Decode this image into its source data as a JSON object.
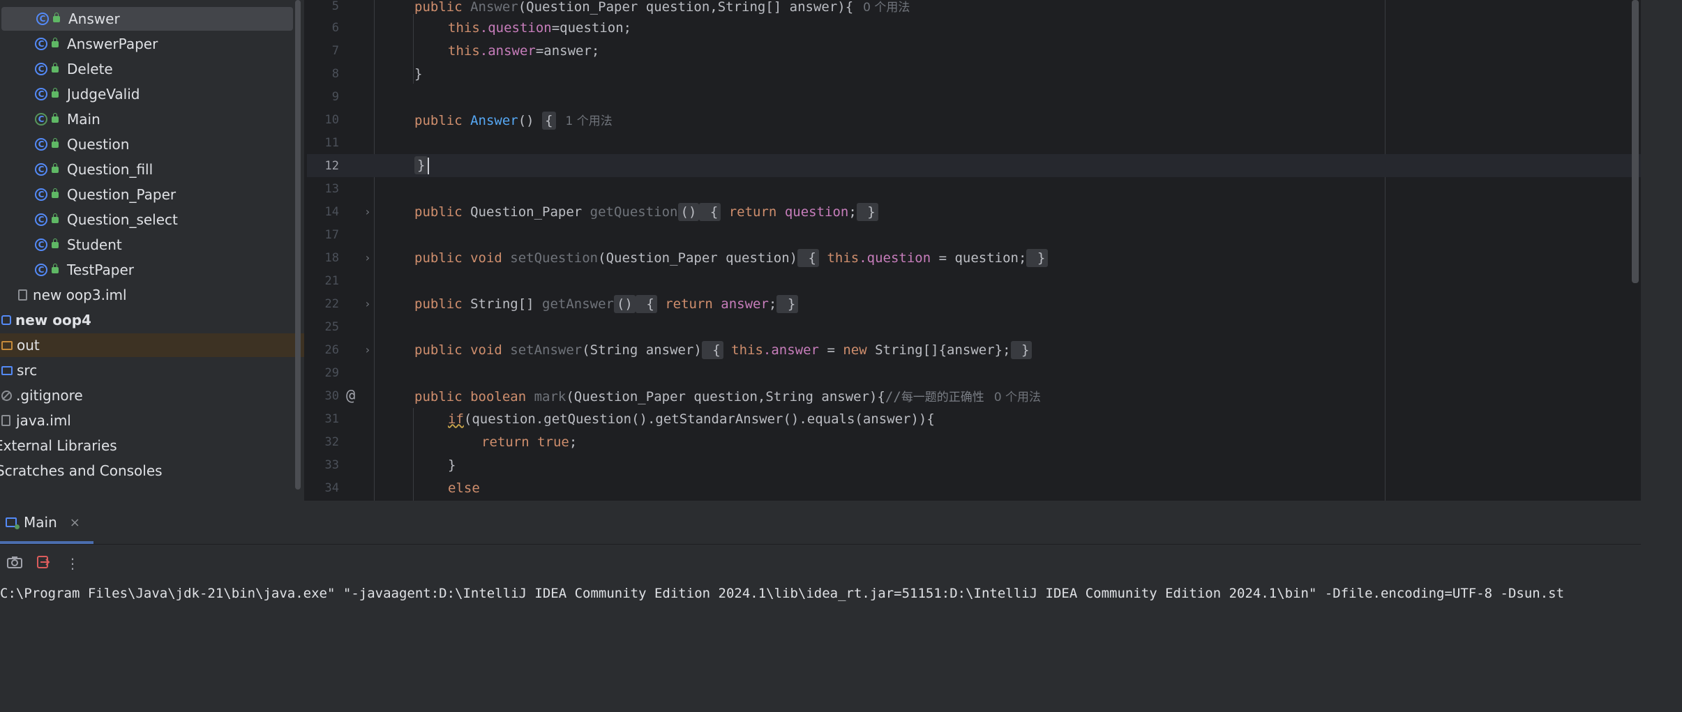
{
  "project_tree": {
    "items": [
      {
        "label": "Answer",
        "kind": "class",
        "selected": true
      },
      {
        "label": "AnswerPaper",
        "kind": "class"
      },
      {
        "label": "Delete",
        "kind": "class"
      },
      {
        "label": "JudgeValid",
        "kind": "class"
      },
      {
        "label": "Main",
        "kind": "main-class"
      },
      {
        "label": "Question",
        "kind": "class"
      },
      {
        "label": "Question_fill",
        "kind": "class"
      },
      {
        "label": "Question_Paper",
        "kind": "class"
      },
      {
        "label": "Question_select",
        "kind": "class"
      },
      {
        "label": "Student",
        "kind": "class"
      },
      {
        "label": "TestPaper",
        "kind": "class"
      },
      {
        "label": "new oop3.iml",
        "kind": "iml-file"
      },
      {
        "label": "new oop4",
        "kind": "module"
      },
      {
        "label": "out",
        "kind": "folder-excluded"
      },
      {
        "label": "src",
        "kind": "folder"
      },
      {
        "label": ".gitignore",
        "kind": "ignore-file"
      },
      {
        "label": "java.iml",
        "kind": "iml-file"
      },
      {
        "label": "External Libraries",
        "kind": "libraries"
      },
      {
        "label": "Scratches and Consoles",
        "kind": "scratches"
      }
    ]
  },
  "editor": {
    "lines": {
      "l5": {
        "num": "5",
        "kw": "public",
        "name": "Answer",
        "params": "(Question_Paper question,String[] answer){",
        "hint": "0 个用法"
      },
      "l6": {
        "num": "6",
        "this": "this",
        "field": ".question",
        "rest": "=question;"
      },
      "l7": {
        "num": "7",
        "this": "this",
        "field": ".answer",
        "rest": "=answer;"
      },
      "l8": {
        "num": "8",
        "text": "}"
      },
      "l9": {
        "num": "9"
      },
      "l10": {
        "num": "10",
        "kw": "public",
        "name": "Answer",
        "rest": "() ",
        "brace": "{",
        "hint": "1 个用法"
      },
      "l11": {
        "num": "11"
      },
      "l12": {
        "num": "12",
        "text": "}"
      },
      "l13": {
        "num": "13"
      },
      "l14": {
        "num": "14",
        "kw": "public",
        "type": " Question_Paper ",
        "name": "getQuestion",
        "paren": "()",
        "ob": " {",
        "ret": " return",
        "field": " question",
        "semi": ";",
        "cb": " }"
      },
      "l17": {
        "num": "17"
      },
      "l18": {
        "num": "18",
        "kw": "public void",
        "name": " setQuestion",
        "params": "(Question_Paper question)",
        "ob": " {",
        "this": " this",
        "field": ".question",
        "rest": " = question;",
        "cb": " }"
      },
      "l21": {
        "num": "21"
      },
      "l22": {
        "num": "22",
        "kw": "public",
        "type": " String[] ",
        "name": "getAnswer",
        "paren": "()",
        "ob": " {",
        "ret": " return",
        "field": " answer",
        "semi": ";",
        "cb": " }"
      },
      "l25": {
        "num": "25"
      },
      "l26": {
        "num": "26",
        "kw": "public void",
        "name": " setAnswer",
        "params": "(String answer)",
        "ob": " {",
        "this": " this",
        "field": ".answer",
        "rest": " = ",
        "new": "new",
        "rest2": " String[]{answer};",
        "cb": " }"
      },
      "l29": {
        "num": "29"
      },
      "l30": {
        "num": "30",
        "kw": "public boolean",
        "name": " mark",
        "params": "(Question_Paper question,String answer){",
        "comment": "//",
        "comment_cn": "每一题的正确性",
        "hint": "0 个用法",
        "gutter": "@"
      },
      "l31": {
        "num": "31",
        "if": "if",
        "rest": "(question.getQuestion().getStandarAnswer().equals(answer)){"
      },
      "l32": {
        "num": "32",
        "ret": "return",
        "tru": " true",
        "semi": ";"
      },
      "l33": {
        "num": "33",
        "text": "}"
      },
      "l34": {
        "num": "34",
        "kw": "else"
      }
    }
  },
  "run_panel": {
    "tab_label": "Main",
    "close_glyph": "×",
    "console_line": "C:\\Program Files\\Java\\jdk-21\\bin\\java.exe\" \"-javaagent:D:\\IntelliJ IDEA Community Edition 2024.1\\lib\\idea_rt.jar=51151:D:\\IntelliJ IDEA Community Edition 2024.1\\bin\" -Dfile.encoding=UTF-8 -Dsun.st"
  }
}
